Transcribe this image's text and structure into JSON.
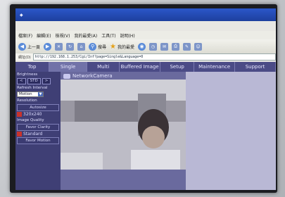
{
  "browser": {
    "menu": [
      "檔案(F)",
      "編輯(E)",
      "檢視(V)",
      "我的最愛(A)",
      "工具(T)",
      "說明(H)"
    ],
    "toolbar": {
      "back_label": "上一頁",
      "search_label": "搜尋",
      "favorites_label": "我的最愛"
    },
    "address_label": "網址(D)",
    "url": "http://192.168.1.253/Cgi/Inf?page=Single&Language=0"
  },
  "app": {
    "tabs": [
      {
        "label": "Top",
        "active": false
      },
      {
        "label": "Single",
        "active": true
      },
      {
        "label": "Multi",
        "active": false
      },
      {
        "label": "Buffered Image",
        "active": false
      },
      {
        "label": "Setup",
        "active": false
      },
      {
        "label": "Maintenance",
        "active": false
      },
      {
        "label": "Support",
        "active": false
      }
    ],
    "sidebar": {
      "brightness_label": "Brightness",
      "std_button": "STD",
      "refresh_label": "Refresh Interval",
      "refresh_value": "Motion",
      "resolution_label": "Resolution",
      "auto_button": "Autosize",
      "res_value": "320x240",
      "quality_label": "Image Quality",
      "clarity_button": "Favor Clarity",
      "standard_value": "Standard",
      "motion_button": "Favor Motion"
    },
    "camera_title": "NetworkCamera"
  },
  "colors": {
    "nav": "#4b4b86",
    "active_tab": "#7172a8",
    "sidebar": "#3f3f75",
    "accent_red": "#c8332d"
  }
}
